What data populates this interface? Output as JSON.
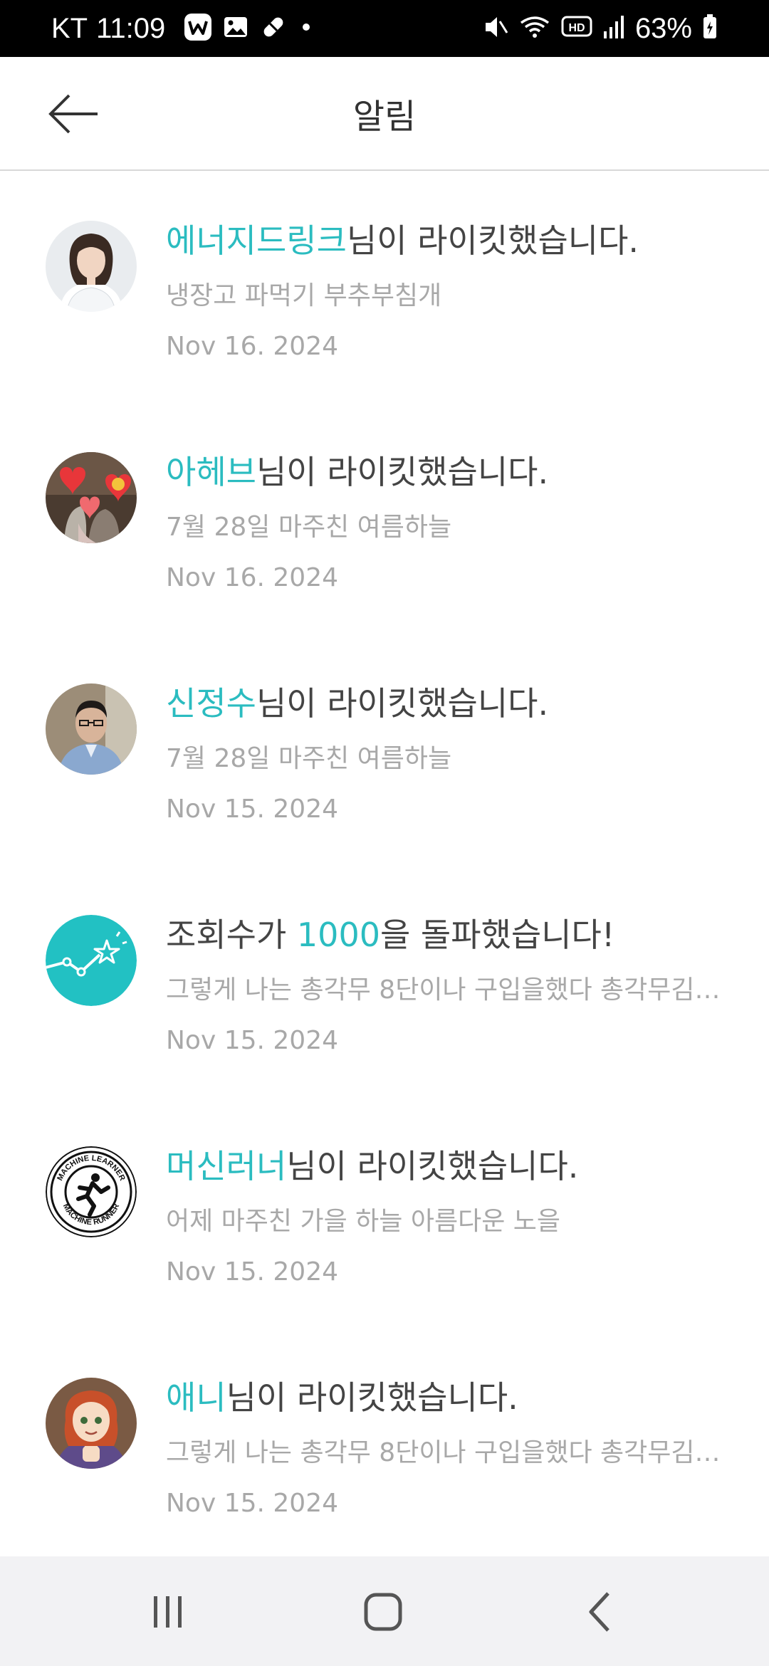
{
  "status_bar": {
    "carrier": "KT",
    "time": "11:09",
    "left_icons": [
      "w-app-icon",
      "gallery-icon",
      "pill-icon",
      "dot-icon"
    ],
    "right_icons": [
      "mute-icon",
      "wifi-icon",
      "hd-icon",
      "signal-icon"
    ],
    "battery": "63%"
  },
  "app_bar": {
    "title": "알림",
    "back_icon": "arrow-left-icon"
  },
  "notifications": [
    {
      "name": "에너지드링크",
      "suffix": "님이 라이킷했습니다.",
      "subtitle": "냉장고 파먹기 부추부침개",
      "date": "Nov 16. 2024",
      "avatar": "woman-portrait"
    },
    {
      "name": "아헤브",
      "suffix": "님이 라이킷했습니다.",
      "subtitle": "7월 28일 마주친 여름하늘",
      "date": "Nov 16. 2024",
      "avatar": "family-with-hearts"
    },
    {
      "name": "신정수",
      "suffix": "님이 라이킷했습니다.",
      "subtitle": "7월 28일 마주친 여름하늘",
      "date": "Nov 15. 2024",
      "avatar": "man-portrait"
    },
    {
      "prefix": "조회수가 ",
      "name": "1000",
      "suffix": "을 돌파했습니다!",
      "subtitle": "그렇게 나는 총각무 8단이나 구입을했다 총각무김…",
      "date": "Nov 15. 2024",
      "avatar": "views-chart-star"
    },
    {
      "name": "머신러너",
      "suffix": "님이 라이킷했습니다.",
      "subtitle": "어제 마주친 가을 하늘 아름다운 노을",
      "date": "Nov 15. 2024",
      "avatar": "machine-runner-logo",
      "avatar_text_top": "MACHINE LEARNER",
      "avatar_text_bottom": "MACHINE RUNNER"
    },
    {
      "name": "애니",
      "suffix": "님이 라이킷했습니다.",
      "subtitle": "그렇게 나는 총각무 8단이나 구입을했다 총각무김…",
      "date": "Nov 15. 2024",
      "avatar": "anime-girl"
    }
  ],
  "nav_bar": {
    "buttons": [
      "recent-apps-icon",
      "home-icon",
      "back-icon"
    ]
  },
  "colors": {
    "accent": "#2bbcc0",
    "text": "#444444",
    "muted": "#a8a8a8",
    "navbar_bg": "#f2f2f4"
  }
}
